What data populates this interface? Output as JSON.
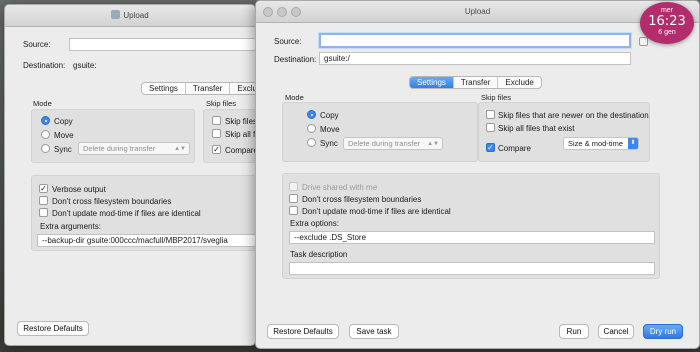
{
  "back_window": {
    "title": "Upload",
    "source_label": "Source:",
    "source_value": "",
    "destination_label": "Destination:",
    "destination_value": "gsuite:",
    "tabs": [
      "Settings",
      "Transfer",
      "Exclude"
    ],
    "mode_title": "Mode",
    "mode_options": [
      "Copy",
      "Move",
      "Sync"
    ],
    "sync_select": "Delete during transfer",
    "skip_title": "Skip files",
    "skip_opt1": "Skip files th",
    "skip_opt2": "Skip all file",
    "compare_label": "Compare",
    "opt_verbose": "Verbose output",
    "opt_cross": "Don't cross filesystem boundaries",
    "opt_modtime": "Don't update mod-time if files are identical",
    "extra_label": "Extra arguments:",
    "extra_value": "--backup-dir gsuite:000ccc/macfull/MBP2017/sveglia",
    "restore_button": "Restore Defaults"
  },
  "front_window": {
    "title": "Upload",
    "source_label": "Source:",
    "source_value": "",
    "destination_label": "Destination:",
    "destination_value": "gsuite:/",
    "tabs": [
      "Settings",
      "Transfer",
      "Exclude"
    ],
    "mode_title": "Mode",
    "mode_options": [
      "Copy",
      "Move",
      "Sync"
    ],
    "sync_select": "Delete during transfer",
    "skip_title": "Skip files",
    "skip_newer": "Skip files that are newer on the destination",
    "skip_exist": "Skip all files that exist",
    "compare_label": "Compare",
    "compare_select": "Size & mod-time",
    "opt_drive_shared": "Drive shared with me",
    "opt_cross": "Don't cross filesystem boundaries",
    "opt_modtime": "Don't update mod-time if files are identical",
    "extra_label": "Extra options:",
    "extra_value": "--exclude .DS_Store",
    "task_label": "Task description",
    "task_value": "",
    "restore_button": "Restore Defaults",
    "save_button": "Save task",
    "run_button": "Run",
    "cancel_button": "Cancel",
    "dryrun_button": "Dry run"
  },
  "clock": {
    "day": "mer",
    "time": "16:23",
    "date": "6 gen"
  },
  "colors": {
    "accent": "#3b86ef",
    "clock_bg": "#b32c6b"
  }
}
